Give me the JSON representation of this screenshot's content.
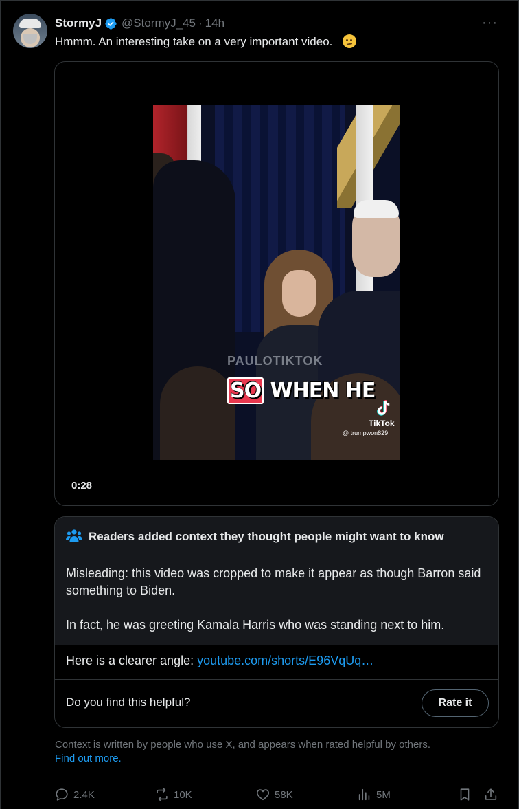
{
  "tweet": {
    "name": "StormyJ",
    "handle": "@StormyJ_45",
    "separator": "·",
    "time": "14h",
    "more": "···",
    "text": "Hmmm.  An interesting take on a very important video."
  },
  "media": {
    "watermark": "PAULOTIKTOK",
    "caption_highlight": "SO",
    "caption_rest": " WHEN HE",
    "tiktok_label": "TikTok",
    "tiktok_user": "@ trumpwon829",
    "duration": "0:28"
  },
  "community_note": {
    "title": "Readers added context they thought people might want to know",
    "paragraph1": "Misleading: this video was cropped to make it appear as though Barron said something to Biden.",
    "paragraph2": "In fact, he was greeting Kamala Harris who was standing next to him.",
    "angle_prefix": "Here is a clearer angle: ",
    "angle_link": "youtube.com/shorts/E96VqUq…",
    "helpful_question": "Do you find this helpful?",
    "rate_button": "Rate it"
  },
  "footer": {
    "context_text": "Context is written by people who use X, and appears when rated helpful by others.",
    "find_out_more": "Find out more."
  },
  "actions": {
    "replies": "2.4K",
    "reposts": "10K",
    "likes": "58K",
    "views": "5M"
  },
  "colors": {
    "background": "#000000",
    "text": "#e7e9ea",
    "muted": "#71767b",
    "accent": "#1d9bf0",
    "note_background": "#16181c",
    "border": "#2f3336"
  }
}
